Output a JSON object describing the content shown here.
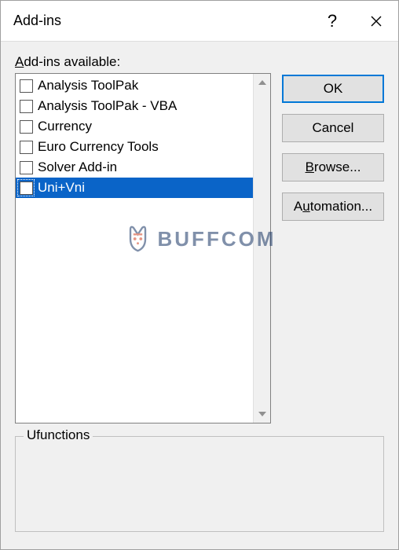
{
  "titlebar": {
    "title": "Add-ins"
  },
  "list": {
    "label_prefix": "A",
    "label_rest": "dd-ins available:",
    "items": [
      {
        "label": "Analysis ToolPak",
        "checked": false,
        "selected": false
      },
      {
        "label": "Analysis ToolPak - VBA",
        "checked": false,
        "selected": false
      },
      {
        "label": "Currency",
        "checked": false,
        "selected": false
      },
      {
        "label": "Euro Currency Tools",
        "checked": false,
        "selected": false
      },
      {
        "label": "Solver Add-in",
        "checked": false,
        "selected": false
      },
      {
        "label": "Uni+Vni",
        "checked": false,
        "selected": true
      }
    ]
  },
  "buttons": {
    "ok": "OK",
    "cancel": "Cancel",
    "browse_ul": "B",
    "browse_rest": "rowse...",
    "automation_pre": "A",
    "automation_ul": "u",
    "automation_rest": "tomation..."
  },
  "groupbox": {
    "label": "Ufunctions"
  },
  "watermark": {
    "text": "BUFFCOM"
  }
}
